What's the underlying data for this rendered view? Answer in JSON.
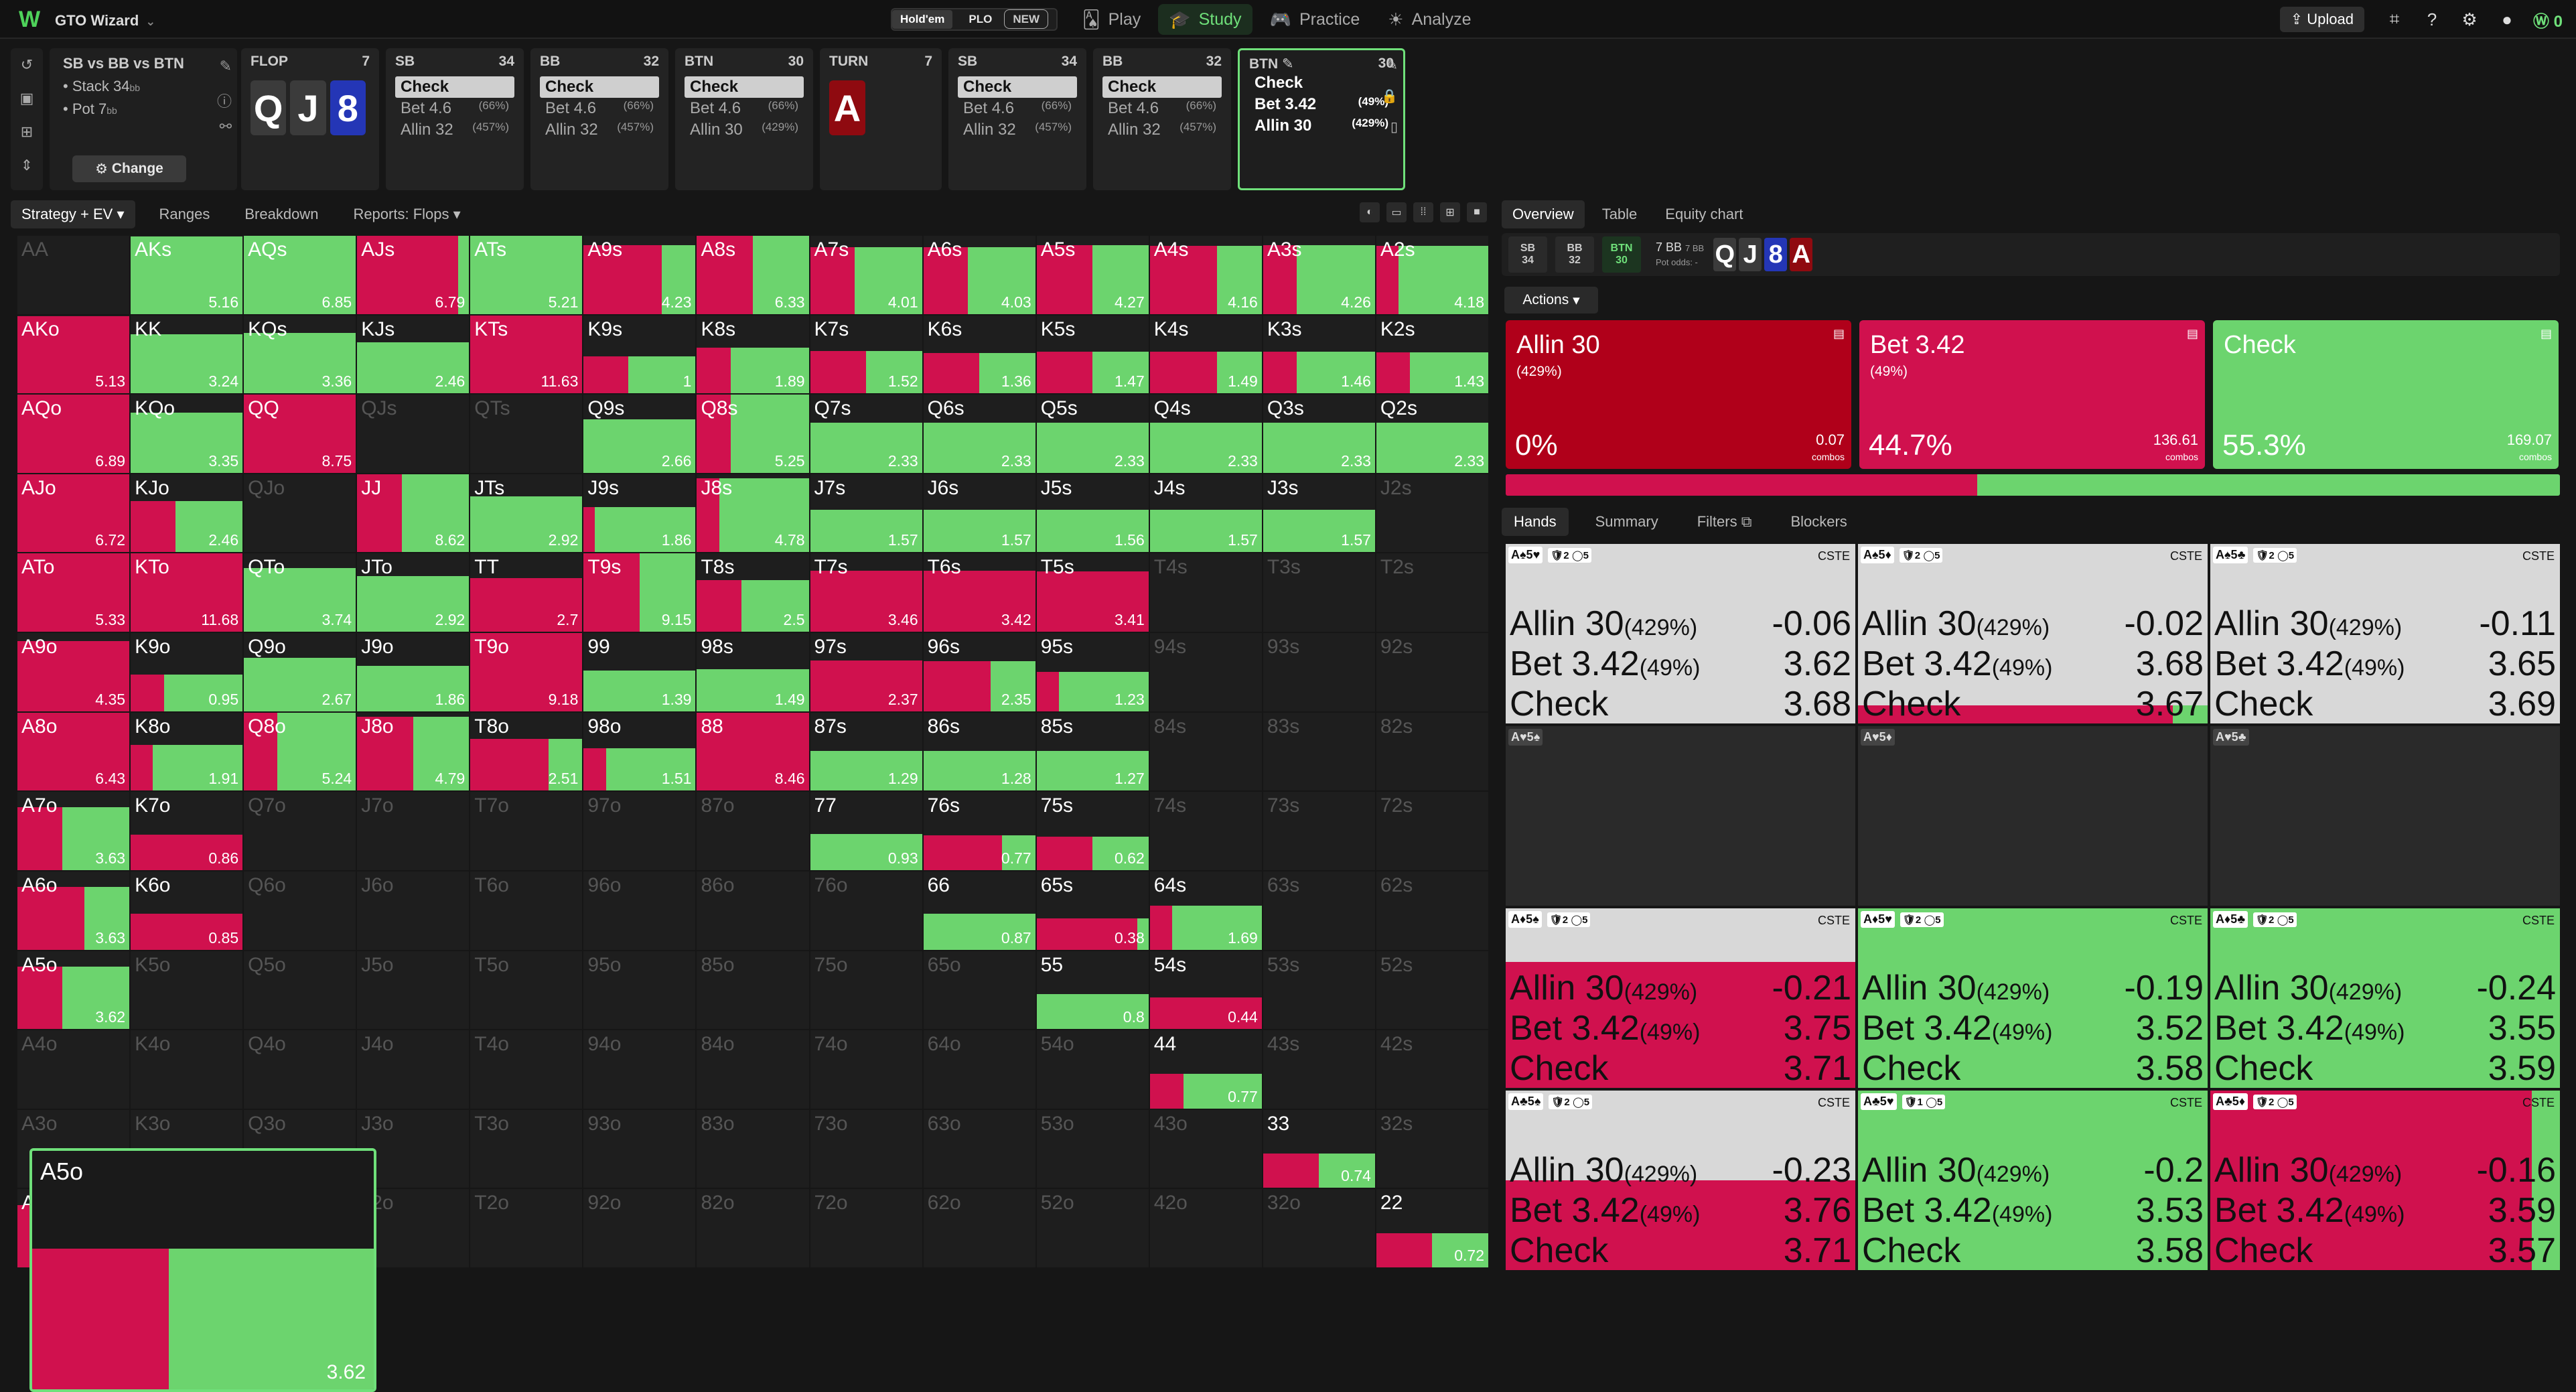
{
  "app": {
    "logo": "W",
    "title": "GTO Wizard"
  },
  "game_toggle": {
    "holdem": "Hold'em",
    "plo": "PLO",
    "new": "NEW"
  },
  "nav": [
    {
      "icon": "cards-icon",
      "glyph": "🂡",
      "label": "Play"
    },
    {
      "icon": "study-icon",
      "glyph": "🎓",
      "label": "Study",
      "active": true
    },
    {
      "icon": "controller-icon",
      "glyph": "🎮",
      "label": "Practice"
    },
    {
      "icon": "analyze-icon",
      "glyph": "☀",
      "label": "Analyze"
    }
  ],
  "topright": {
    "upload": "Upload",
    "coins": "0"
  },
  "scenario": {
    "title": "SB vs BB vs BTN",
    "stack": "Stack 34",
    "pot": "Pot 7",
    "bb": "bb",
    "change": "Change"
  },
  "action_cards": [
    {
      "pos": "FLOP",
      "num": "7",
      "cards": [
        {
          "r": "Q",
          "s": "spade"
        },
        {
          "r": "J",
          "s": "spade"
        },
        {
          "r": "8",
          "s": "blue"
        }
      ],
      "actions": []
    },
    {
      "pos": "SB",
      "num": "34",
      "actions": [
        {
          "t": "Check",
          "check": true
        },
        {
          "t": "Bet 4.6",
          "p": "(66%)"
        },
        {
          "t": "Allin 32",
          "p": "(457%)"
        }
      ]
    },
    {
      "pos": "BB",
      "num": "32",
      "actions": [
        {
          "t": "Check",
          "check": true
        },
        {
          "t": "Bet 4.6",
          "p": "(66%)"
        },
        {
          "t": "Allin 32",
          "p": "(457%)"
        }
      ]
    },
    {
      "pos": "BTN",
      "num": "30",
      "actions": [
        {
          "t": "Check",
          "check": true
        },
        {
          "t": "Bet 4.6",
          "p": "(66%)"
        },
        {
          "t": "Allin 30",
          "p": "(429%)"
        }
      ]
    },
    {
      "pos": "TURN",
      "num": "7",
      "cards": [
        {
          "r": "A",
          "s": "red"
        }
      ],
      "actions": []
    },
    {
      "pos": "SB",
      "num": "34",
      "actions": [
        {
          "t": "Check",
          "check": true
        },
        {
          "t": "Bet 4.6",
          "p": "(66%)"
        },
        {
          "t": "Allin 32",
          "p": "(457%)"
        }
      ]
    },
    {
      "pos": "BB",
      "num": "32",
      "actions": [
        {
          "t": "Check",
          "check": true
        },
        {
          "t": "Bet 4.6",
          "p": "(66%)"
        },
        {
          "t": "Allin 32",
          "p": "(457%)"
        }
      ]
    },
    {
      "pos": "BTN",
      "num": "30",
      "selected": true,
      "actions": [
        {
          "t": "Check"
        },
        {
          "t": "Bet 3.42",
          "p": "(49%)"
        },
        {
          "t": "Allin 30",
          "p": "(429%)"
        }
      ]
    }
  ],
  "left_tabs": [
    "Strategy + EV",
    "Ranges",
    "Breakdown",
    "Reports: Flops"
  ],
  "grid": [
    [
      "AA|d",
      "AKs|0,0,1|5.16",
      "AQs|0,0,1|6.85",
      "AJs|0,.9,.1|6.79",
      "ATs|0,0,1|5.21",
      "A9s|0,.7,.3|4.23",
      "A8s|0,.5,.5|6.33",
      "A7s|0,.4,.6|4.01",
      "A6s|0,.4,.6|4.03",
      "A5s|0,.5,.5|4.27",
      "A4s|0,.6,.4|4.16",
      "A3s|0,.3,.7|4.26",
      "A2s|0,.2,.8|4.18"
    ],
    [
      "AKo|0,1,0|5.13",
      "KK|0,0,1|3.24",
      "KQs|0,0,1|3.36",
      "KJs|0,0,1|2.46",
      "KTs|0,1,0|11.63",
      "K9s|0,.4,.6|1",
      "K8s|0,.3,.7|1.89",
      "K7s|0,.5,.5|1.52",
      "K6s|0,.5,.5|1.36",
      "K5s|0,.5,.5|1.47",
      "K4s|0,.6,.4|1.49",
      "K3s|0,.3,.7|1.46",
      "K2s|0,.3,.7|1.43"
    ],
    [
      "AQo|0,1,0|6.89",
      "KQo|0,0,1|3.35",
      "QQ|0,1,0|8.75",
      "QJs|d",
      "QTs|d",
      "Q9s|0,0,1|2.66",
      "Q8s|0,.3,.7|5.25",
      "Q7s|0,0,1|2.33",
      "Q6s|0,0,1|2.33",
      "Q5s|0,0,1|2.33",
      "Q4s|0,0,1|2.33",
      "Q3s|0,0,1|2.33",
      "Q2s|0,0,1|2.33"
    ],
    [
      "AJo|0,1,0|6.72",
      "KJo|0,.4,.6|2.46",
      "QJo|d",
      "JJ|0,.4,.6|8.62",
      "JTs|0,0,1|2.92",
      "J9s|0,.1,.9|1.86",
      "J8s|0,.2,.8|4.78",
      "J7s|0,0,1|1.57",
      "J6s|0,0,1|1.57",
      "J5s|0,0,1|1.56",
      "J4s|0,0,1|1.57",
      "J3s|0,0,1|1.57",
      "J2s|d"
    ],
    [
      "ATo|0,1,0|5.33",
      "KTo|0,1,0|11.68",
      "QTo|0,0,1|3.74",
      "JTo|0,0,1|2.92",
      "TT|0,1,0|2.7",
      "T9s|0,.5,.5|9.15",
      "T8s|0,.4,.6|2.5",
      "T7s|0,1,0|3.46",
      "T6s|0,1,0|3.42",
      "T5s|0,1,0|3.41",
      "T4s|d",
      "T3s|d",
      "T2s|d"
    ],
    [
      "A9o|0,1,0|4.35",
      "K9o|0,.3,.7|0.95",
      "Q9o|0,0,1|2.67",
      "J9o|0,0,1|1.86",
      "T9o|0,1,0|9.18",
      "99|0,0,1|1.39",
      "98s|0,0,1|1.49",
      "97s|0,1,0|2.37",
      "96s|0,.6,.4|2.35",
      "95s|0,.2,.8|1.23",
      "94s|d",
      "93s|d",
      "92s|d"
    ],
    [
      "A8o|0,1,0|6.43",
      "K8o|0,.2,.8|1.91",
      "Q8o|0,.3,.7|5.24",
      "J8o|0,.5,.5|4.79",
      "T8o|0,.7,.3|2.51",
      "98o|0,.2,.8|1.51",
      "88|0,1,0|8.46",
      "87s|0,0,1|1.29",
      "86s|0,0,1|1.28",
      "85s|0,0,1|1.27",
      "84s|d",
      "83s|d",
      "82s|d"
    ],
    [
      "A7o|0,.4,.6|3.63",
      "K7o|0,1,0|0.86",
      "Q7o|d",
      "J7o|d",
      "T7o|d",
      "97o|d",
      "87o|d",
      "77|0,0,1|0.93",
      "76s|0,.7,.3|0.77",
      "75s|0,.5,.5|0.62",
      "74s|d",
      "73s|d",
      "72s|d"
    ],
    [
      "A6o|0,.6,.4|3.63",
      "K6o|0,1,0|0.85",
      "Q6o|d",
      "J6o|d",
      "T6o|d",
      "96o|d",
      "86o|d",
      "76o|d",
      "66|0,0,1|0.87",
      "65s|0,.9,.1|0.38",
      "64s|0,.2,.8|1.69",
      "63s|d",
      "62s|d"
    ],
    [
      "A5o|0,.4,.6|3.62",
      "K5o|d",
      "Q5o|d",
      "J5o|d",
      "T5o|d",
      "95o|d",
      "85o|d",
      "75o|d",
      "65o|d",
      "55|0,0,1|0.8",
      "54s|0,1,0|0.44",
      "53s|d",
      "52s|d"
    ],
    [
      "A4o|d",
      "K4o|d",
      "Q4o|d",
      "J4o|d",
      "T4o|d",
      "94o|d",
      "84o|d",
      "74o|d",
      "64o|d",
      "54o|d",
      "44|0,.3,.7|0.77",
      "43s|d",
      "42s|d"
    ],
    [
      "A3o|d",
      "K3o|d",
      "Q3o|d",
      "J3o|d",
      "T3o|d",
      "93o|d",
      "83o|d",
      "73o|d",
      "63o|d",
      "53o|d",
      "43o|d",
      "33|0,.5,.5|0.74",
      "32s|d"
    ],
    [
      "A2o|0,.3,.7|3.61",
      "K2o|d",
      "Q2o|d",
      "J2o|d",
      "T2o|d",
      "92o|d",
      "82o|d",
      "72o|d",
      "62o|d",
      "52o|d",
      "42o|d",
      "32o|d",
      "22|0,.5,.5|0.72"
    ]
  ],
  "magnifier": {
    "label": "A5o",
    "ev": "3.62",
    "red": 0.4,
    "green": 0.6
  },
  "right_tabs": [
    "Overview",
    "Table",
    "Equity chart"
  ],
  "pot_players": [
    {
      "p": "SB",
      "v": "34"
    },
    {
      "p": "BB",
      "v": "32"
    },
    {
      "p": "BTN",
      "v": "30",
      "act": true
    }
  ],
  "pot_info": {
    "main": "7 BB",
    "sub": "7 BB",
    "odds": "Pot odds: -"
  },
  "board_mini": [
    {
      "r": "Q",
      "c": "#3b3b3b"
    },
    {
      "r": "J",
      "c": "#3b3b3b"
    },
    {
      "r": "8",
      "c": "#2436b6"
    },
    {
      "r": "A",
      "c": "#8f0a10"
    }
  ],
  "actions_dd": "Actions",
  "big_actions": [
    {
      "name": "Allin 30",
      "pct_of_pot": "(429%)",
      "freq": "0%",
      "combos": "0.07",
      "combos_label": "combos",
      "color": "#b0001a"
    },
    {
      "name": "Bet 3.42",
      "pct_of_pot": "(49%)",
      "freq": "44.7%",
      "combos": "136.61",
      "combos_label": "combos",
      "color": "#d0114e"
    },
    {
      "name": "Check",
      "pct_of_pot": "",
      "freq": "55.3%",
      "combos": "169.07",
      "combos_label": "combos",
      "color": "#6cd46e"
    }
  ],
  "freq_bar": {
    "allin": 0.0,
    "bet": 0.447,
    "check": 0.553
  },
  "hand_tabs": [
    "Hands",
    "Summary",
    "Filters",
    "Blockers"
  ],
  "combos": [
    {
      "hand": "A♠5♥",
      "b1": "2",
      "b2": "5",
      "tag": "CSTE",
      "bg": "#d8d8d8",
      "allin": "-0.06",
      "bet": "3.62",
      "check": "3.68",
      "fill": [
        0,
        0,
        0
      ]
    },
    {
      "hand": "A♠5♦",
      "b1": "2",
      "b2": "5",
      "tag": "CSTE",
      "bg": "#d8d8d8",
      "allin": "-0.02",
      "bet": "3.68",
      "check": "3.67",
      "fill": [
        0,
        0.9,
        0.1
      ],
      "fill_h": 0.1
    },
    {
      "hand": "A♠5♣",
      "b1": "2",
      "b2": "5",
      "tag": "CSTE",
      "bg": "#d8d8d8",
      "allin": "-0.11",
      "bet": "3.65",
      "check": "3.69",
      "fill": [
        0,
        0,
        0
      ]
    },
    {
      "hand": "A♥5♠",
      "empty": true
    },
    {
      "hand": "A♥5♦",
      "empty": true
    },
    {
      "hand": "A♥5♣",
      "empty": true
    },
    {
      "hand": "A♦5♠",
      "b1": "2",
      "b2": "5",
      "tag": "CSTE",
      "bg": "#d8d8d8",
      "allin": "-0.21",
      "bet": "3.75",
      "check": "3.71",
      "fill": [
        0,
        1,
        0
      ],
      "fill_h": 0.7
    },
    {
      "hand": "A♦5♥",
      "b1": "2",
      "b2": "5",
      "tag": "CSTE",
      "bg": "#6cd46e",
      "allin": "-0.19",
      "bet": "3.52",
      "check": "3.58",
      "fill": [
        0,
        0,
        1
      ],
      "fill_h": 1
    },
    {
      "hand": "A♦5♣",
      "b1": "2",
      "b2": "5",
      "tag": "CSTE",
      "bg": "#6cd46e",
      "allin": "-0.24",
      "bet": "3.55",
      "check": "3.59",
      "fill": [
        0,
        0,
        1
      ],
      "fill_h": 1
    },
    {
      "hand": "A♣5♠",
      "b1": "2",
      "b2": "5",
      "tag": "CSTE",
      "bg": "#d8d8d8",
      "allin": "-0.23",
      "bet": "3.76",
      "check": "3.71",
      "fill": [
        0,
        1,
        0
      ],
      "fill_h": 0.5
    },
    {
      "hand": "A♣5♥",
      "b1": "1",
      "b2": "5",
      "tag": "CSTE",
      "bg": "#6cd46e",
      "allin": "-0.2",
      "bet": "3.53",
      "check": "3.58",
      "fill": [
        0,
        0,
        1
      ],
      "fill_h": 1
    },
    {
      "hand": "A♣5♦",
      "b1": "2",
      "b2": "5",
      "tag": "CSTE",
      "bg": "#d0114e",
      "allin": "-0.16",
      "bet": "3.59",
      "check": "3.57",
      "fill": [
        0,
        0.92,
        0.08
      ],
      "fill_h": 1
    }
  ],
  "combo_labels": {
    "allin": "Allin 30",
    "allin_p": "(429%)",
    "bet": "Bet 3.42",
    "bet_p": "(49%)",
    "check": "Check"
  },
  "colors": {
    "allin": "#b0001a",
    "bet": "#d0114e",
    "check": "#6cd46e",
    "accent": "#6fe07a"
  }
}
